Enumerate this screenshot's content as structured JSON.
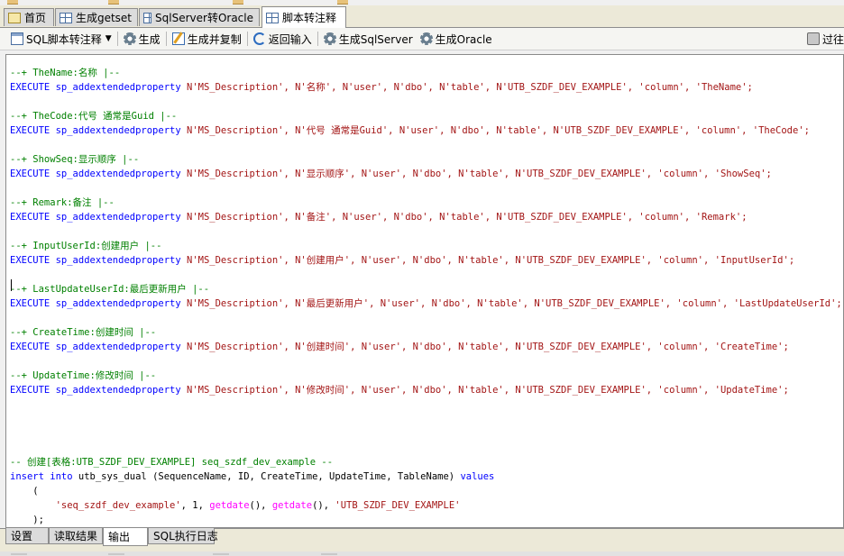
{
  "tabs": [
    {
      "label": "首页",
      "icon": "home-icon"
    },
    {
      "label": "生成getset",
      "icon": "grid-icon"
    },
    {
      "label": "SqlServer转Oracle",
      "icon": "grid-icon"
    },
    {
      "label": "脚本转注释",
      "icon": "grid-icon",
      "active": true
    }
  ],
  "toolbar": {
    "mode_dropdown": "SQL脚本转注释",
    "generate": "生成",
    "generate_copy": "生成并复制",
    "back_input": "返回输入",
    "gen_sqlserver": "生成SqlServer",
    "gen_oracle": "生成Oracle",
    "filter": "过往"
  },
  "editor": {
    "sections": [
      {
        "comment": "--+ TheName:名称 |--",
        "exec": "EXECUTE",
        "proc": "sp_addextendedproperty",
        "args": " N'MS_Description', N'名称', N'user', N'dbo', N'table', N'UTB_SZDF_DEV_EXAMPLE', 'column', 'TheName';"
      },
      {
        "comment": "--+ TheCode:代号 通常是Guid |--",
        "exec": "EXECUTE",
        "proc": "sp_addextendedproperty",
        "args": " N'MS_Description', N'代号 通常是Guid', N'user', N'dbo', N'table', N'UTB_SZDF_DEV_EXAMPLE', 'column', 'TheCode';"
      },
      {
        "comment": "--+ ShowSeq:显示顺序 |--",
        "exec": "EXECUTE",
        "proc": "sp_addextendedproperty",
        "args": " N'MS_Description', N'显示顺序', N'user', N'dbo', N'table', N'UTB_SZDF_DEV_EXAMPLE', 'column', 'ShowSeq';"
      },
      {
        "comment": "--+ Remark:备注 |--",
        "exec": "EXECUTE",
        "proc": "sp_addextendedproperty",
        "args": " N'MS_Description', N'备注', N'user', N'dbo', N'table', N'UTB_SZDF_DEV_EXAMPLE', 'column', 'Remark';"
      },
      {
        "comment": "--+ InputUserId:创建用户 |--",
        "exec": "EXECUTE",
        "proc": "sp_addextendedproperty",
        "args": " N'MS_Description', N'创建用户', N'user', N'dbo', N'table', N'UTB_SZDF_DEV_EXAMPLE', 'column', 'InputUserId';"
      },
      {
        "comment": "--+ LastUpdateUserId:最后更新用户 |--",
        "exec": "EXECUTE",
        "proc": "sp_addextendedproperty",
        "args": " N'MS_Description', N'最后更新用户', N'user', N'dbo', N'table', N'UTB_SZDF_DEV_EXAMPLE', 'column', 'LastUpdateUserId';"
      },
      {
        "comment": "--+ CreateTime:创建时间 |--",
        "exec": "EXECUTE",
        "proc": "sp_addextendedproperty",
        "args": " N'MS_Description', N'创建时间', N'user', N'dbo', N'table', N'UTB_SZDF_DEV_EXAMPLE', 'column', 'CreateTime';"
      },
      {
        "comment": "--+ UpdateTime:修改时间 |--",
        "exec": "EXECUTE",
        "proc": "sp_addextendedproperty",
        "args": " N'MS_Description', N'修改时间', N'user', N'dbo', N'table', N'UTB_SZDF_DEV_EXAMPLE', 'column', 'UpdateTime';"
      }
    ],
    "insert_comment": "-- 创建[表格:UTB_SZDF_DEV_EXAMPLE] seq_szdf_dev_example --",
    "insert_kw1": "insert",
    "insert_kw2": "into",
    "insert_target": " utb_sys_dual (SequenceName, ID, CreateTime, UpdateTime, TableName) ",
    "insert_kw3": "values",
    "open_paren": "    (",
    "v_indent": "        ",
    "v_seq": "'seq_szdf_dev_example'",
    "v_sep1": ", 1, ",
    "v_fn1": "getdate",
    "v_paren1": "(), ",
    "v_fn2": "getdate",
    "v_paren2": "(), ",
    "v_table": "'UTB_SZDF_DEV_EXAMPLE'",
    "close_paren": "    );"
  },
  "bottom_tabs": [
    "设置",
    "读取结果",
    "输出",
    "SQL执行日志"
  ],
  "bottom_active": "输出"
}
